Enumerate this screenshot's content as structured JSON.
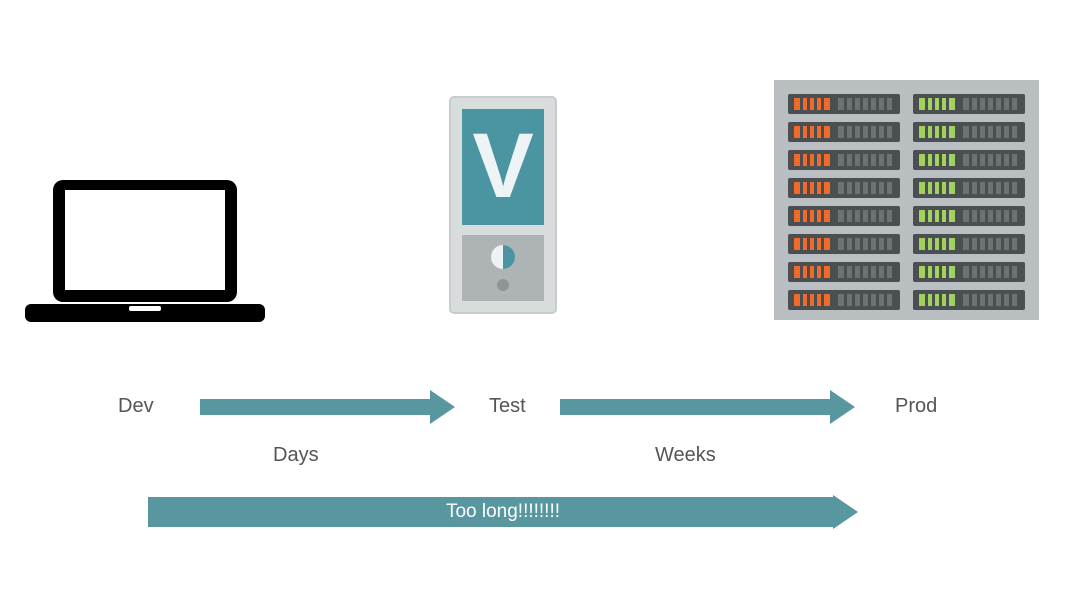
{
  "stages": {
    "dev": {
      "label": "Dev",
      "icon": "laptop-icon"
    },
    "test": {
      "label": "Test",
      "icon": "vserver-icon"
    },
    "prod": {
      "label": "Prod",
      "icon": "server-rack-icon"
    }
  },
  "arrows": {
    "dev_to_test": {
      "duration": "Days"
    },
    "test_to_prod": {
      "duration": "Weeks"
    },
    "overall": {
      "caption": "Too long!!!!!!!!"
    }
  },
  "colors": {
    "accent": "#5896a0",
    "text": "#555555",
    "rack_led_a": "#f06a2a",
    "rack_led_b": "#a0d060"
  }
}
